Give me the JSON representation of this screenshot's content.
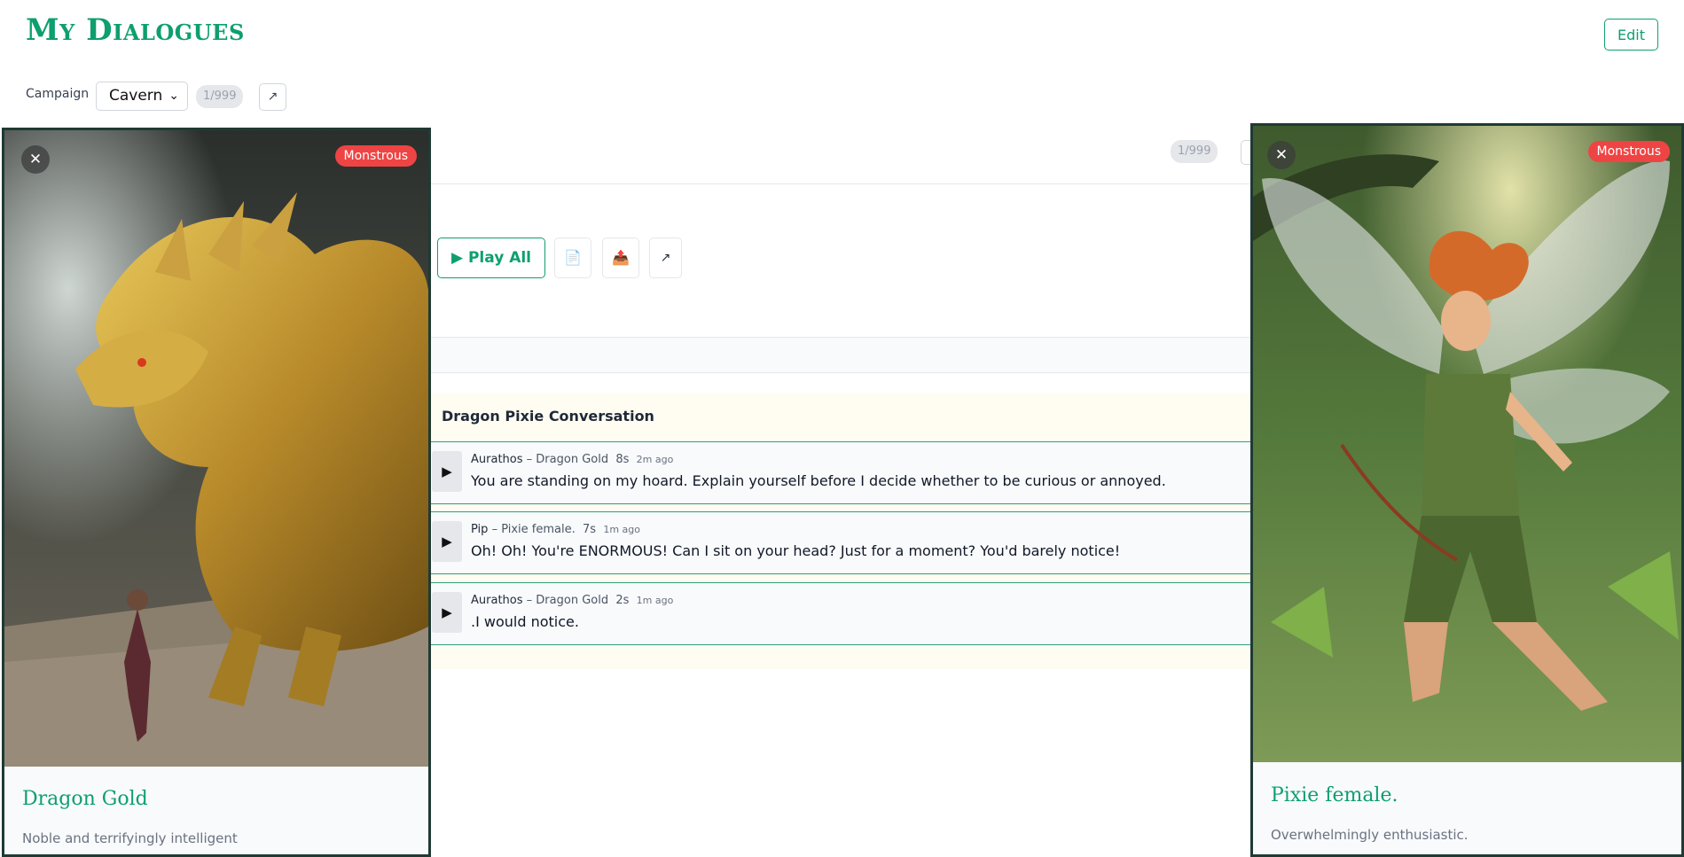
{
  "header": {
    "title": "My Dialogues",
    "edit_label": "Edit"
  },
  "campaign": {
    "label": "Campaign",
    "selected": "Cavern",
    "count": "1/999",
    "open_icon": "↗"
  },
  "toolbar": {
    "count": "1/999",
    "play_all_label": "▶ Play All",
    "doc_icon": "📄",
    "export_icon": "📤",
    "open_icon": "↗"
  },
  "conversation": {
    "title": "Dragon Pixie Conversation",
    "lines": [
      {
        "speaker": "Aurathos",
        "role": "Dragon Gold",
        "duration": "8s",
        "ago": "2m ago",
        "text": "You are standing on my hoard. Explain yourself before I decide whether to be curious or annoyed."
      },
      {
        "speaker": "Pip",
        "role": "Pixie female.",
        "duration": "7s",
        "ago": "1m ago",
        "text": "Oh! Oh! You're ENORMOUS! Can I sit on your head? Just for a moment? You'd barely notice!"
      },
      {
        "speaker": "Aurathos",
        "role": "Dragon Gold",
        "duration": "2s",
        "ago": "1m ago",
        "text": ".I would notice."
      }
    ],
    "play_icon": "▶",
    "dash": "–"
  },
  "cards": {
    "left": {
      "badge": "Monstrous",
      "name": "Dragon Gold",
      "desc": "Noble and terrifyingly intelligent",
      "close": "✕"
    },
    "right": {
      "badge": "Monstrous",
      "name": "Pixie female.",
      "desc": "Overwhelmingly enthusiastic.",
      "close": "✕"
    }
  },
  "colors": {
    "accent": "#0e9f6e",
    "badge": "#ef4444",
    "card_border": "#1f3a33"
  }
}
